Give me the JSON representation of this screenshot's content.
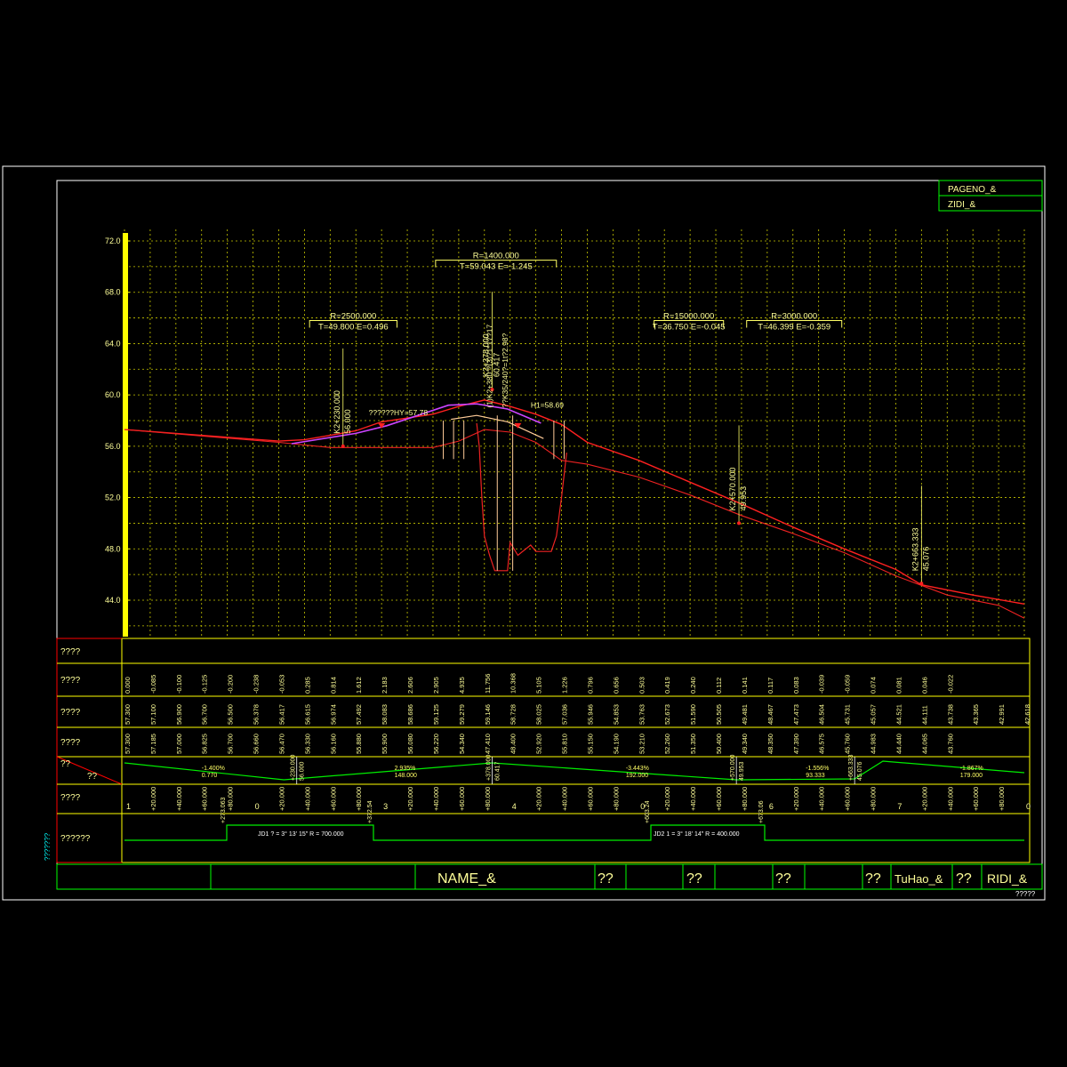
{
  "title_block": {
    "page_no": "PAGENO_&",
    "total": "ZIDI_&",
    "name": "NAME_&",
    "label1": "??",
    "label2": "??",
    "label3": "??",
    "label4": "??",
    "tuhao": "TuHao_&",
    "label5": "??",
    "ridi": "RIDI_&"
  },
  "side_note": "???????",
  "corner_note": "?????",
  "row_labels": [
    "????",
    "????",
    "????",
    "????",
    "??",
    "??",
    "????",
    "??????"
  ],
  "chart_data": {
    "type": "line",
    "y_ticks": [
      "72.0",
      "68.0",
      "64.0",
      "60.0",
      "56.0",
      "52.0",
      "48.0",
      "44.0"
    ],
    "ylim": [
      42.0,
      73.5
    ],
    "xlim": [
      0,
      35
    ],
    "grid": true,
    "series": [
      {
        "values": [
          [
            0,
            57.3
          ],
          [
            2,
            57.0
          ],
          [
            4,
            56.7
          ],
          [
            6,
            56.4
          ],
          [
            7,
            56.5
          ],
          [
            9,
            57.2
          ],
          [
            10,
            57.9
          ],
          [
            12,
            58.5
          ],
          [
            13,
            59.1
          ],
          [
            14,
            59.6
          ],
          [
            15,
            59.1
          ],
          [
            16,
            58.5
          ],
          [
            17,
            57.7
          ],
          [
            18,
            56.3
          ],
          [
            20,
            54.9
          ],
          [
            22,
            53.2
          ],
          [
            24,
            51.5
          ],
          [
            26,
            49.7
          ],
          [
            28,
            48.0
          ],
          [
            30,
            46.4
          ],
          [
            31,
            45.2
          ],
          [
            33,
            44.4
          ],
          [
            35,
            43.7
          ]
        ]
      },
      {
        "values": [
          [
            0,
            57.3
          ],
          [
            3,
            56.8
          ],
          [
            6,
            56.3
          ],
          [
            8,
            55.9
          ],
          [
            10,
            55.9
          ],
          [
            12,
            55.9
          ],
          [
            13,
            56.4
          ],
          [
            14,
            57.3
          ],
          [
            15,
            57.1
          ],
          [
            16,
            56.3
          ],
          [
            17,
            54.9
          ],
          [
            18,
            54.6
          ],
          [
            20,
            53.6
          ],
          [
            22,
            52.2
          ],
          [
            24,
            50.6
          ],
          [
            26,
            49.2
          ],
          [
            28,
            47.7
          ],
          [
            30,
            45.9
          ],
          [
            32,
            44.4
          ],
          [
            34,
            43.6
          ],
          [
            35,
            42.6
          ]
        ]
      },
      {
        "values": [
          [
            6.5,
            56.2
          ],
          [
            9,
            57.0
          ],
          [
            10.2,
            57.6
          ],
          [
            12.6,
            59.2
          ],
          [
            13.7,
            59.3
          ],
          [
            14.9,
            58.9
          ],
          [
            16.2,
            57.8
          ]
        ]
      },
      {
        "values": [
          [
            12.7,
            58.1
          ],
          [
            13.7,
            58.4
          ],
          [
            14.9,
            57.9
          ],
          [
            16.3,
            56.6
          ]
        ]
      },
      {
        "values": [
          [
            13.7,
            57.8
          ],
          [
            13.8,
            56.0
          ],
          [
            13.9,
            52.0
          ],
          [
            14.0,
            49.0
          ],
          [
            14.2,
            47.5
          ],
          [
            14.4,
            46.3
          ],
          [
            14.9,
            46.3
          ],
          [
            15.0,
            48.5
          ],
          [
            15.3,
            47.5
          ],
          [
            15.8,
            48.3
          ],
          [
            16.0,
            47.8
          ],
          [
            16.6,
            47.8
          ],
          [
            16.8,
            49.0
          ],
          [
            17.0,
            52.0
          ],
          [
            17.2,
            55.5
          ]
        ]
      }
    ],
    "points": [
      {
        "x": 8.5,
        "y": 56.0,
        "label": "K2+230.000",
        "sublabel": "56.000"
      },
      {
        "x": 14.3,
        "y": 60.417,
        "label": "K2+378.000",
        "sublabel": "60.417"
      },
      {
        "x": 23.9,
        "y": 50.0,
        "label": "K2+570.000",
        "sublabel": "49.953"
      },
      {
        "x": 31.0,
        "y": 45.3,
        "label": "K2+663.333",
        "sublabel": "45.076"
      }
    ],
    "curves": [
      {
        "x1": 7.2,
        "x2": 10.6,
        "y": 65.8,
        "radius": "R=2500.000",
        "params": "T=49.800 E=0.496"
      },
      {
        "x1": 12.1,
        "x2": 16.8,
        "y": 70.5,
        "radius": "R=1400.000",
        "params": "T=59.043 E=-1.245"
      },
      {
        "x1": 20.6,
        "x2": 23.3,
        "y": 65.8,
        "radius": "R=15000.000",
        "params": "T=36.750 E=-0.045"
      },
      {
        "x1": 24.2,
        "x2": 27.9,
        "y": 65.8,
        "radius": "R=3000.000",
        "params": "T=46.399 E=-0.359"
      }
    ],
    "annotations": [
      {
        "x": 9.5,
        "y": 58.4,
        "text": "??????HY=57.78"
      },
      {
        "x": 15.8,
        "y": 59.0,
        "text": "H1=58.69"
      },
      {
        "x": 14.3,
        "y": 59.0,
        "text": "(1)K2+380 ?(3)?1*17?17"
      },
      {
        "x": 14.9,
        "y": 59.0,
        "text": "??K35/240?=1t?2.98?"
      }
    ],
    "design_elev": [
      "0.000",
      "-0.085",
      "-0.100",
      "-0.125",
      "-0.200",
      "-0.238",
      "-0.053",
      "0.285",
      "0.814",
      "1.612",
      "2.183",
      "2.606",
      "2.905",
      "4.935",
      "11.756",
      "10.368",
      "5.105",
      "1.226",
      "0.796",
      "0.656",
      "0.503",
      "0.419",
      "0.240",
      "0.112",
      "0.141",
      "0.117",
      "0.083",
      "-0.039",
      "-0.059",
      "0.074",
      "0.081",
      "0.046",
      "-0.022"
    ],
    "design_values": [
      "57.300",
      "57.100",
      "56.900",
      "56.700",
      "56.500",
      "56.378",
      "56.417",
      "56.615",
      "56.974",
      "57.492",
      "58.083",
      "58.686",
      "59.125",
      "59.279",
      "59.146",
      "58.728",
      "58.025",
      "57.036",
      "55.946",
      "54.853",
      "53.763",
      "52.673",
      "51.590",
      "50.505",
      "49.481",
      "48.467",
      "47.473",
      "46.504",
      "45.731",
      "45.057",
      "44.521",
      "44.111",
      "43.738",
      "43.365",
      "42.991",
      "42.618"
    ],
    "ground_values": [
      "57.300",
      "57.185",
      "57.000",
      "56.825",
      "56.700",
      "56.660",
      "56.470",
      "56.330",
      "56.160",
      "55.880",
      "55.900",
      "56.080",
      "56.220",
      "54.340",
      "47.410",
      "48.400",
      "52.920",
      "55.810",
      "55.150",
      "54.190",
      "53.210",
      "52.260",
      "51.350",
      "50.400",
      "49.340",
      "48.350",
      "47.390",
      "46.575",
      "45.760",
      "44.983",
      "44.440",
      "44.065",
      "43.760"
    ],
    "grades": [
      {
        "percent": "-1.400%",
        "length": "0.770",
        "x": 3.0
      },
      {
        "percent": "2.935%",
        "length": "148.000",
        "x": 10.5
      },
      {
        "percent": "-3.443%",
        "length": "192.000",
        "x": 19.5
      },
      {
        "percent": "-1.556%",
        "length": "93.333",
        "x": 26.5
      },
      {
        "percent": "-1.867%",
        "length": "179.000",
        "x": 32.5
      }
    ],
    "grade_markers": [
      {
        "top": "+230.000",
        "bottom": "56.000",
        "x": 6.7
      },
      {
        "top": "+378.000",
        "bottom": "60.417",
        "x": 14.3
      },
      {
        "top": "+570.000",
        "bottom": "49.953",
        "x": 23.8
      },
      {
        "top": "+663.333",
        "bottom": "45.076",
        "x": 28.4
      }
    ],
    "stations": [
      "1",
      "+20.000",
      "+40.000",
      "+60.000",
      "+80.000",
      "0",
      "+20.000",
      "+40.000",
      "+60.000",
      "+80.000",
      "3",
      "+20.000",
      "+40.000",
      "+60.000",
      "+80.000",
      "4",
      "+20.000",
      "+40.000",
      "+60.000",
      "+80.000",
      "0",
      "+20.000",
      "+40.000",
      "+60.000",
      "+80.000",
      "6",
      "+20.000",
      "+40.000",
      "+60.000",
      "+80.000",
      "7",
      "+20.000",
      "+40.000",
      "+60.000",
      "+80.000",
      "0"
    ],
    "alignment": [
      {
        "text": "JD1 ? = 3° 13' 15\"  R = 700.000",
        "x": 5.0
      },
      {
        "text": "JD2 1 = 3° 18' 14\"  R = 400.000",
        "x": 22.0
      }
    ],
    "alignment_markers": [
      "+273.063",
      "+372.54",
      "+603.24",
      "+673.06"
    ]
  }
}
